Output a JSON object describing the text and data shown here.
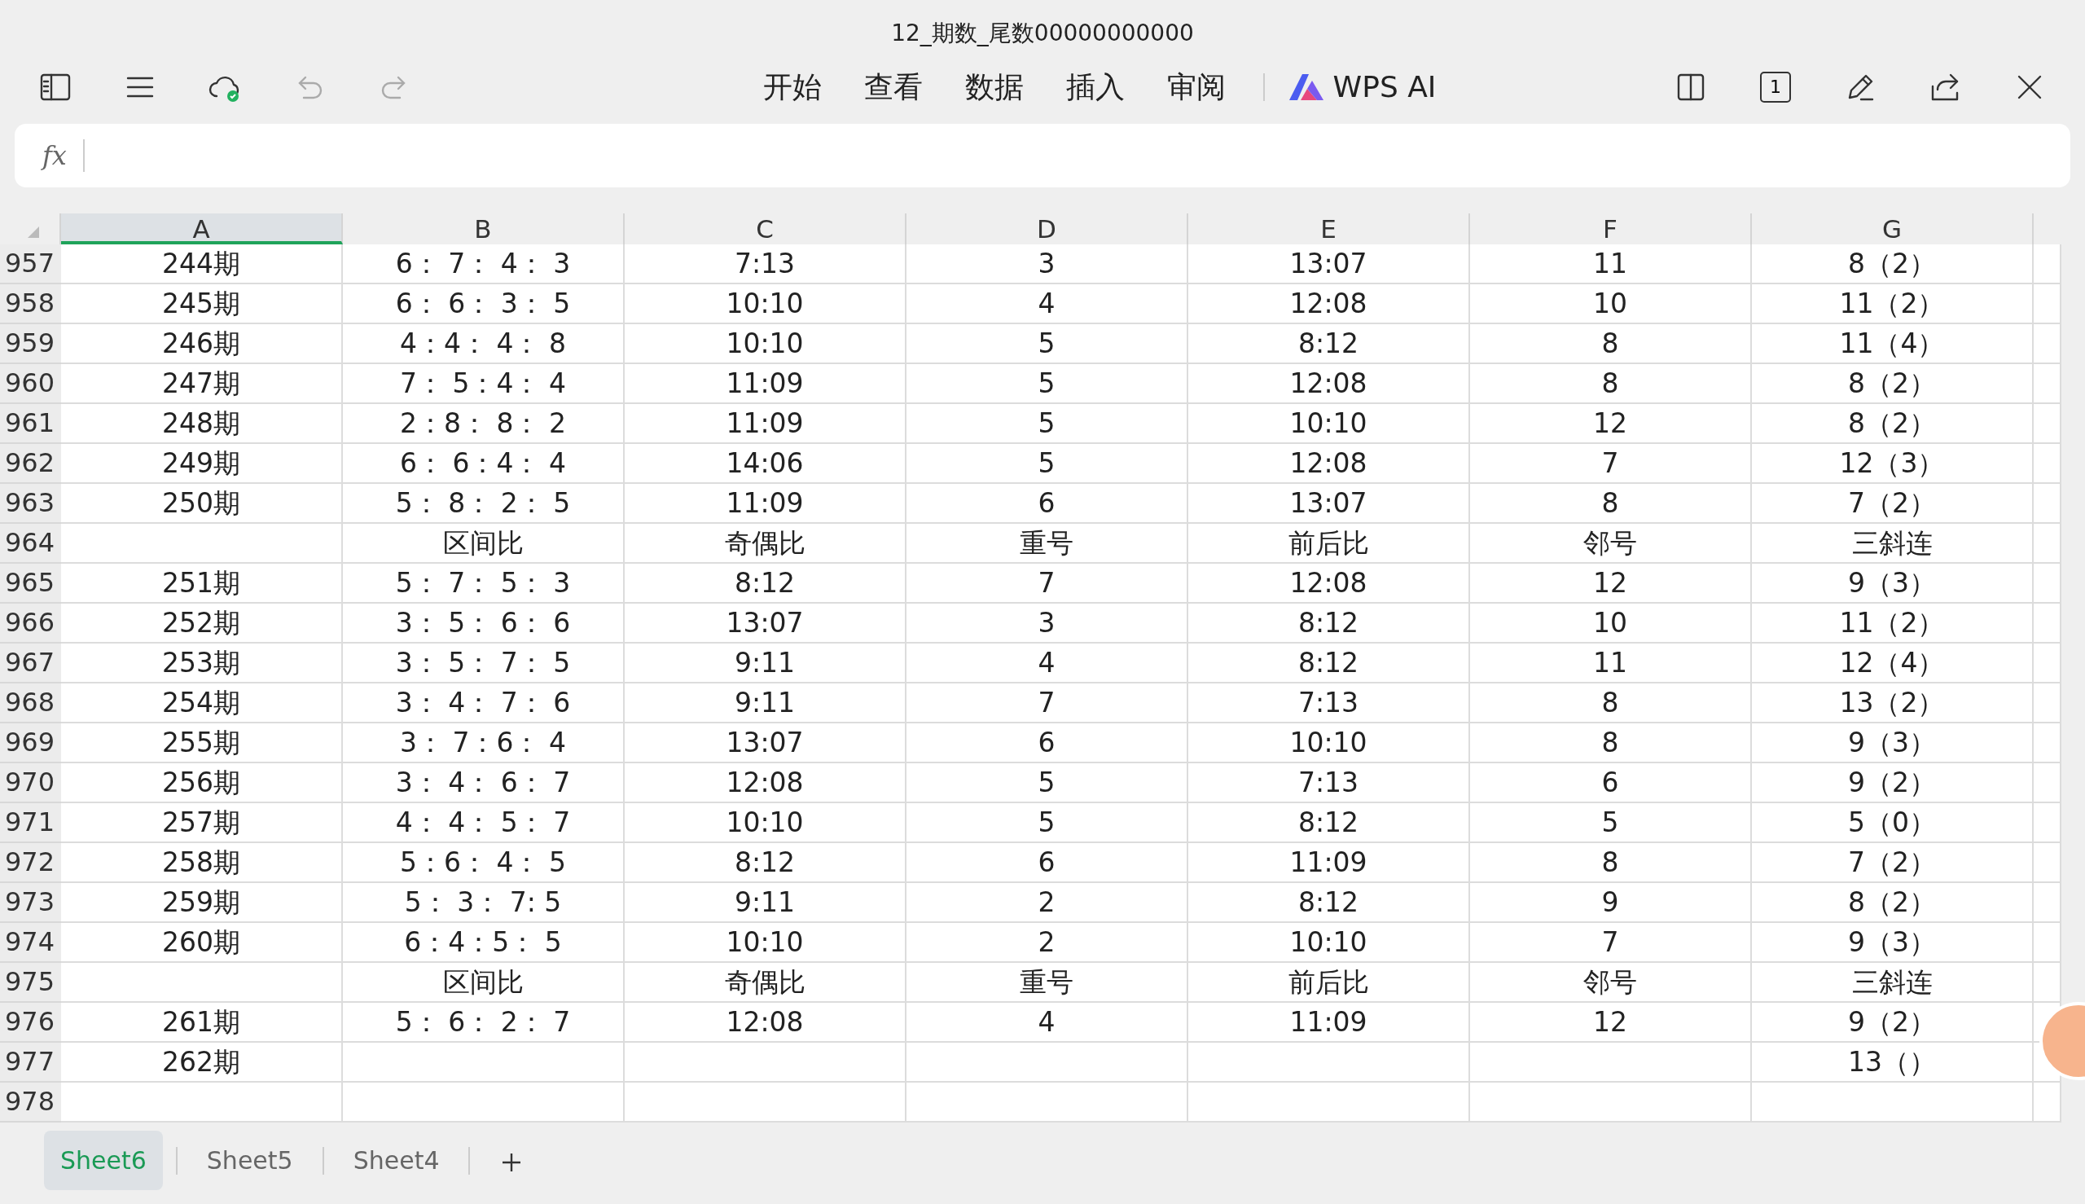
{
  "window": {
    "title": "12_期数_尾数00000000000"
  },
  "toolbar": {
    "menu_tabs": [
      "开始",
      "查看",
      "数据",
      "插入",
      "审阅"
    ],
    "ai_label": "WPS AI",
    "page_number": "1"
  },
  "formula_bar": {
    "label": "fx"
  },
  "columns": [
    {
      "label": "A",
      "selected": true
    },
    {
      "label": "B",
      "selected": false
    },
    {
      "label": "C",
      "selected": false
    },
    {
      "label": "D",
      "selected": false
    },
    {
      "label": "E",
      "selected": false
    },
    {
      "label": "F",
      "selected": false
    },
    {
      "label": "G",
      "selected": false
    }
  ],
  "rows": [
    {
      "number": "957",
      "cells": [
        "244期",
        "6： 7： 4： 3",
        "7:13",
        "3",
        "13:07",
        "11",
        "8（2）"
      ]
    },
    {
      "number": "958",
      "cells": [
        "245期",
        "6： 6： 3： 5",
        "10:10",
        "4",
        "12:08",
        "10",
        "11（2）"
      ]
    },
    {
      "number": "959",
      "cells": [
        "246期",
        "4：4： 4： 8",
        "10:10",
        "5",
        "8:12",
        "8",
        "11（4）"
      ]
    },
    {
      "number": "960",
      "cells": [
        "247期",
        "7： 5：4： 4",
        "11:09",
        "5",
        "12:08",
        "8",
        "8（2）"
      ]
    },
    {
      "number": "961",
      "cells": [
        "248期",
        "2：8： 8： 2",
        "11:09",
        "5",
        "10:10",
        "12",
        "8（2）"
      ]
    },
    {
      "number": "962",
      "cells": [
        "249期",
        "6： 6：4： 4",
        "14:06",
        "5",
        "12:08",
        "7",
        "12（3）"
      ]
    },
    {
      "number": "963",
      "cells": [
        "250期",
        "5： 8： 2： 5",
        "11:09",
        "6",
        "13:07",
        "8",
        "7（2）"
      ]
    },
    {
      "number": "964",
      "cells": [
        "",
        "区间比",
        "奇偶比",
        "重号",
        "前后比",
        "邻号",
        "三斜连"
      ]
    },
    {
      "number": "965",
      "cells": [
        "251期",
        "5： 7： 5： 3",
        "8:12",
        "7",
        "12:08",
        "12",
        "9（3）"
      ]
    },
    {
      "number": "966",
      "cells": [
        "252期",
        "3： 5： 6： 6",
        "13:07",
        "3",
        "8:12",
        "10",
        "11（2）"
      ]
    },
    {
      "number": "967",
      "cells": [
        "253期",
        "3： 5： 7： 5",
        "9:11",
        "4",
        "8:12",
        "11",
        "12（4）"
      ]
    },
    {
      "number": "968",
      "cells": [
        "254期",
        "3： 4： 7： 6",
        "9:11",
        "7",
        "7:13",
        "8",
        "13（2）"
      ]
    },
    {
      "number": "969",
      "cells": [
        "255期",
        "3： 7：6： 4",
        "13:07",
        "6",
        "10:10",
        "8",
        "9（3）"
      ]
    },
    {
      "number": "970",
      "cells": [
        "256期",
        "3： 4： 6： 7",
        "12:08",
        "5",
        "7:13",
        "6",
        "9（2）"
      ]
    },
    {
      "number": "971",
      "cells": [
        "257期",
        "4： 4： 5： 7",
        "10:10",
        "5",
        "8:12",
        "5",
        "5（0）"
      ]
    },
    {
      "number": "972",
      "cells": [
        "258期",
        "5：6： 4： 5",
        "8:12",
        "6",
        "11:09",
        "8",
        "7（2）"
      ]
    },
    {
      "number": "973",
      "cells": [
        "259期",
        "5： 3： 7: 5",
        "9:11",
        "2",
        "8:12",
        "9",
        "8（2）"
      ]
    },
    {
      "number": "974",
      "cells": [
        "260期",
        "6：4：5： 5",
        "10:10",
        "2",
        "10:10",
        "7",
        "9（3）"
      ]
    },
    {
      "number": "975",
      "cells": [
        "",
        "区间比",
        "奇偶比",
        "重号",
        "前后比",
        "邻号",
        "三斜连"
      ]
    },
    {
      "number": "976",
      "cells": [
        "261期",
        "5： 6： 2： 7",
        "12:08",
        "4",
        "11:09",
        "12",
        "9（2）"
      ]
    },
    {
      "number": "977",
      "cells": [
        "262期",
        "",
        "",
        "",
        "",
        "",
        "13（）"
      ]
    },
    {
      "number": "978",
      "cells": [
        "",
        "",
        "",
        "",
        "",
        "",
        ""
      ]
    }
  ],
  "sheet_tabs": [
    {
      "label": "Sheet6",
      "selected": true
    },
    {
      "label": "Sheet5",
      "selected": false
    },
    {
      "label": "Sheet4",
      "selected": false
    }
  ]
}
